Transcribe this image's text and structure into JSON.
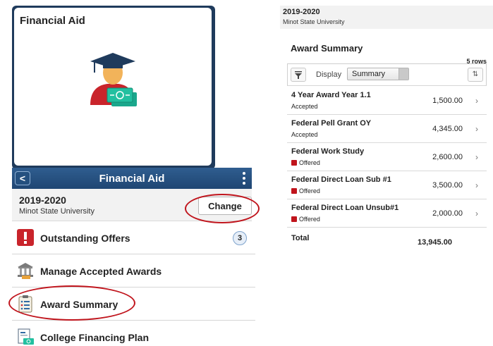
{
  "tile": {
    "title": "Financial Aid",
    "icon": "graduate-with-money-icon"
  },
  "navbar": {
    "back_label": "<",
    "title": "Financial Aid",
    "menu_icon": "kebab-menu-icon"
  },
  "aid_year": {
    "year": "2019-2020",
    "school": "Minot State University",
    "change_label": "Change"
  },
  "menu": {
    "items": [
      {
        "label": "Outstanding Offers",
        "icon": "exclamation-icon",
        "badge": "3"
      },
      {
        "label": "Manage Accepted Awards",
        "icon": "bank-icon"
      },
      {
        "label": "Award Summary",
        "icon": "clipboard-list-icon"
      },
      {
        "label": "College Financing Plan",
        "icon": "document-money-icon"
      }
    ]
  },
  "summary": {
    "header_year": "2019-2020",
    "header_school": "Minot State University",
    "title": "Award Summary",
    "row_count": "5 rows",
    "display_label": "Display",
    "display_value": "Summary",
    "rows": [
      {
        "name": "4 Year Award Year 1.1",
        "status": "Accepted",
        "warn": false,
        "amount": "1,500.00"
      },
      {
        "name": "Federal Pell Grant OY",
        "status": "Accepted",
        "warn": false,
        "amount": "4,345.00"
      },
      {
        "name": "Federal Work Study",
        "status": "Offered",
        "warn": true,
        "amount": "2,600.00"
      },
      {
        "name": "Federal Direct Loan Sub #1",
        "status": "Offered",
        "warn": true,
        "amount": "3,500.00"
      },
      {
        "name": "Federal Direct Loan Unsub#1",
        "status": "Offered",
        "warn": true,
        "amount": "2,000.00"
      }
    ],
    "total_label": "Total",
    "total_amount": "13,945.00"
  },
  "colors": {
    "nav_blue": "#1f4673",
    "annotation_red": "#c0141c",
    "warning_red": "#c0141c"
  }
}
